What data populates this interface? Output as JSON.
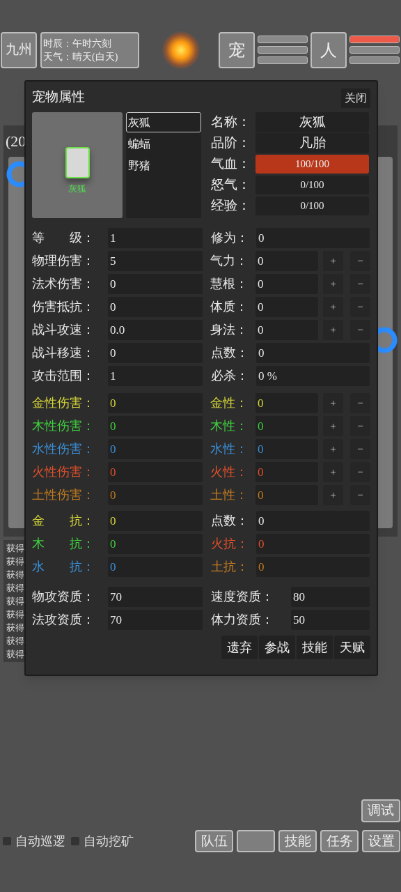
{
  "top_bar": {
    "region": "九州",
    "time": "时辰：午时六刻",
    "weather": "天气：晴天(白天)",
    "pet_button": "宠",
    "person_button": "人",
    "pet_bars": [
      {
        "level": 0
      },
      {
        "level": 0
      },
      {
        "level": 0
      }
    ],
    "person_bars": [
      {
        "level": 1
      },
      {
        "level": 0
      },
      {
        "level": 0
      }
    ]
  },
  "background": {
    "panel_text": "(20",
    "log": [
      "获得",
      "获得",
      "获得",
      "获得",
      "获得",
      "获得",
      "获得",
      "获得",
      "获得"
    ]
  },
  "dialog": {
    "title": "宠物属性",
    "close": "关闭",
    "preview_name": "灰狐",
    "pets": [
      {
        "name": "灰狐",
        "selected": true
      },
      {
        "name": "蝙蝠",
        "selected": false
      },
      {
        "name": "野猪",
        "selected": false
      }
    ],
    "info": [
      {
        "label": "名称：",
        "value": "灰狐",
        "kind": "text"
      },
      {
        "label": "品阶：",
        "value": "凡胎",
        "kind": "text"
      },
      {
        "label": "气血：",
        "value": "100/100",
        "kind": "bar",
        "level": 1
      },
      {
        "label": "怒气：",
        "value": "0/100",
        "kind": "bar",
        "level": 0
      },
      {
        "label": "经验：",
        "value": "0/100",
        "kind": "bar",
        "level": 0
      }
    ],
    "stats": [
      {
        "left": {
          "label": "等　　级：",
          "value": "1"
        },
        "right": {
          "label": "修为：",
          "value": "0"
        }
      },
      {
        "left": {
          "label": "物理伤害：",
          "value": "5"
        },
        "right": {
          "label": "气力：",
          "value": "0",
          "buttons": [
            "+",
            "−"
          ]
        }
      },
      {
        "left": {
          "label": "法术伤害：",
          "value": "0"
        },
        "right": {
          "label": "慧根：",
          "value": "0",
          "buttons": [
            "+",
            "−"
          ]
        }
      },
      {
        "left": {
          "label": "伤害抵抗：",
          "value": "0"
        },
        "right": {
          "label": "体质：",
          "value": "0",
          "buttons": [
            "+",
            "−"
          ]
        }
      },
      {
        "left": {
          "label": "战斗攻速：",
          "value": "0.0"
        },
        "right": {
          "label": "身法：",
          "value": "0",
          "buttons": [
            "+",
            "−"
          ]
        }
      },
      {
        "left": {
          "label": "战斗移速：",
          "value": "0"
        },
        "right": {
          "label": "点数：",
          "value": "0"
        }
      },
      {
        "left": {
          "label": "攻击范围：",
          "value": "1"
        },
        "right": {
          "label": "必杀：",
          "value": "0 %"
        }
      }
    ],
    "elements": [
      {
        "left": {
          "label": "金性伤害：",
          "value": "0",
          "color": "#d6d63a"
        },
        "right": {
          "label": "金性：",
          "value": "0",
          "color": "#d6d63a",
          "buttons": [
            "+",
            "−"
          ]
        }
      },
      {
        "left": {
          "label": "木性伤害：",
          "value": "0",
          "color": "#3fcf3f"
        },
        "right": {
          "label": "木性：",
          "value": "0",
          "color": "#3fcf3f",
          "buttons": [
            "+",
            "−"
          ]
        }
      },
      {
        "left": {
          "label": "水性伤害：",
          "value": "0",
          "color": "#3a8fd8"
        },
        "right": {
          "label": "水性：",
          "value": "0",
          "color": "#3a8fd8",
          "buttons": [
            "+",
            "−"
          ]
        }
      },
      {
        "left": {
          "label": "火性伤害：",
          "value": "0",
          "color": "#e0502a"
        },
        "right": {
          "label": "火性：",
          "value": "0",
          "color": "#e0502a",
          "buttons": [
            "+",
            "−"
          ]
        }
      },
      {
        "left": {
          "label": "土性伤害：",
          "value": "0",
          "color": "#c07a20"
        },
        "right": {
          "label": "土性：",
          "value": "0",
          "color": "#c07a20",
          "buttons": [
            "+",
            "−"
          ]
        }
      }
    ],
    "resistances": [
      {
        "left": {
          "label": "金　　抗：",
          "value": "0",
          "color": "#d6d63a"
        },
        "right": {
          "label": "点数：",
          "value": "0"
        }
      },
      {
        "left": {
          "label": "木　　抗：",
          "value": "0",
          "color": "#3fcf3f"
        },
        "right": {
          "label": "火抗：",
          "value": "0",
          "color": "#e0502a"
        }
      },
      {
        "left": {
          "label": "水　　抗：",
          "value": "0",
          "color": "#3a8fd8"
        },
        "right": {
          "label": "土抗：",
          "value": "0",
          "color": "#c07a20"
        }
      }
    ],
    "aptitudes": [
      {
        "left": {
          "label": "物攻资质：",
          "value": "70"
        },
        "right": {
          "label": "速度资质：",
          "value": "80"
        }
      },
      {
        "left": {
          "label": "法攻资质：",
          "value": "70"
        },
        "right": {
          "label": "体力资质：",
          "value": "50"
        }
      }
    ],
    "actions": [
      "遗弃",
      "参战",
      "技能",
      "天赋"
    ]
  },
  "bottom": {
    "debug": "调试",
    "toggles": [
      {
        "label": "自动巡逻",
        "checked": false
      },
      {
        "label": "自动挖矿",
        "checked": false
      }
    ],
    "menu_left": [
      "队伍"
    ],
    "menu_right": [
      "技能",
      "任务",
      "设置"
    ]
  }
}
